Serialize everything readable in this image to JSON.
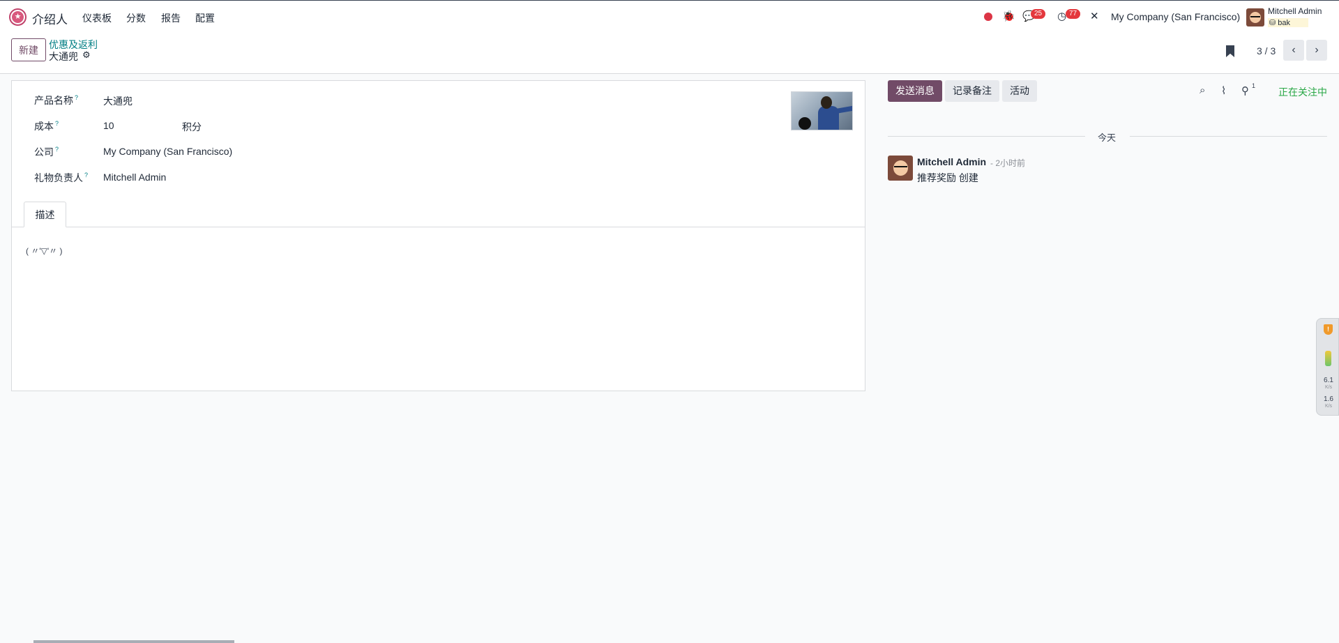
{
  "navbar": {
    "app_name": "介绍人",
    "menu": [
      "仪表板",
      "分数",
      "报告",
      "配置"
    ],
    "messages_count": "25",
    "activities_count": "77",
    "company": "My Company (San Francisco)",
    "user_name": "Mitchell Admin",
    "database": "bak"
  },
  "control": {
    "new_label": "新建",
    "breadcrumb_parent": "优惠及返利",
    "breadcrumb_current": "大通兜",
    "pager": "3 / 3"
  },
  "form": {
    "fields": [
      {
        "label": "产品名称",
        "value": "大通兜"
      },
      {
        "label": "成本",
        "value": "10",
        "unit": "积分"
      },
      {
        "label": "公司",
        "value": "My Company (San Francisco)"
      },
      {
        "label": "礼物负责人",
        "value": "Mitchell Admin"
      }
    ],
    "help_mark": "?",
    "tab_label": "描述",
    "description": "( 〃'▽'〃 )"
  },
  "chatter": {
    "send_message": "发送消息",
    "log_note": "记录备注",
    "activity": "活动",
    "followers_count": "1",
    "following": "正在关注中",
    "date_separator": "今天",
    "message": {
      "author": "Mitchell Admin",
      "time": "- 2小时前",
      "body": "推荐奖励 创建"
    }
  },
  "widget": {
    "shield_label": "!",
    "up_speed": "6.1",
    "down_speed": "1.6",
    "unit": "K/s"
  },
  "colors": {
    "brand": "#714b67",
    "link": "#017e84",
    "following": "#28a745",
    "badge": "#e4383d"
  }
}
